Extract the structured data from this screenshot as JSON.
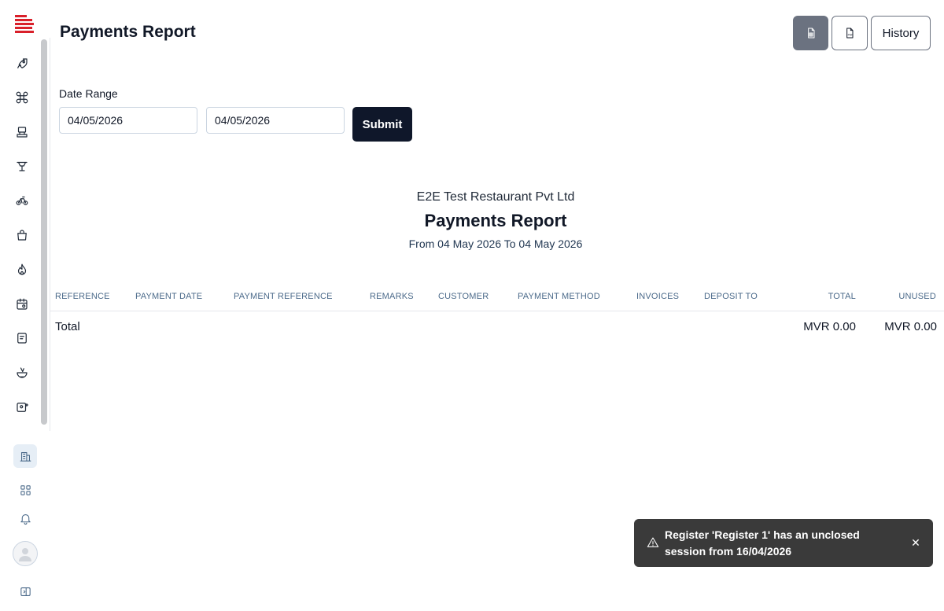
{
  "header": {
    "title": "Payments Report",
    "history_label": "History",
    "excel_icon": "spreadsheet-icon",
    "pdf_icon": "pdf-icon"
  },
  "filter": {
    "label": "Date Range",
    "from": "04/05/2026",
    "to": "04/05/2026",
    "submit_label": "Submit"
  },
  "report": {
    "company": "E2E Test Restaurant Pvt Ltd",
    "title": "Payments Report",
    "range": "From 04 May 2026 To 04 May 2026"
  },
  "table": {
    "columns": [
      "REFERENCE",
      "PAYMENT DATE",
      "PAYMENT REFERENCE",
      "REMARKS",
      "CUSTOMER",
      "PAYMENT METHOD",
      "INVOICES",
      "DEPOSIT TO",
      "TOTAL",
      "UNUSED"
    ],
    "total_row": {
      "label": "Total",
      "total": "MVR 0.00",
      "unused": "MVR 0.00"
    }
  },
  "sidebar": {
    "nav_icons": [
      "rocket-icon",
      "command-icon",
      "register-icon",
      "table-icon",
      "bike-icon",
      "bag-icon",
      "flame-icon",
      "calendar-settings-icon",
      "receipt-icon",
      "bowl-icon",
      "image-plus-icon"
    ],
    "bottom_icons": [
      "building-report-icon",
      "grid-icon",
      "bell-icon",
      "avatar",
      "sidebar-toggle-icon"
    ]
  },
  "toast": {
    "message": "Register 'Register 1' has an unclosed session from 16/04/2026",
    "close_glyph": "✕"
  },
  "colors": {
    "primary": "#0f172a",
    "header_text": "#4b6a8a",
    "toast_bg": "#3a3a3a",
    "logo_red": "#d9202a"
  }
}
